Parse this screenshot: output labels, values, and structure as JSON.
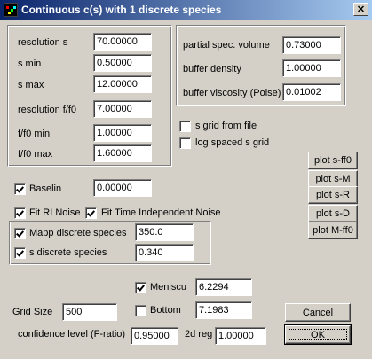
{
  "window": {
    "title": "Continuous c(s) with 1 discrete species",
    "close_glyph": "✕",
    "icon": "sedfit-app-icon"
  },
  "grid_params": {
    "resolution_s": {
      "label": "resolution s",
      "value": "70.00000"
    },
    "s_min": {
      "label": "s min",
      "value": "0.50000"
    },
    "s_max": {
      "label": "s max",
      "value": "12.00000"
    },
    "resolution_ff0": {
      "label": "resolution f/f0",
      "value": "7.00000"
    },
    "ff0_min": {
      "label": "f/f0 min",
      "value": "1.00000"
    },
    "ff0_max": {
      "label": "f/f0 max",
      "value": "1.60000"
    }
  },
  "solution": {
    "partial_spec_volume": {
      "label": "partial spec. volume",
      "value": "0.73000"
    },
    "buffer_density": {
      "label": "buffer density",
      "value": "1.00000"
    },
    "buffer_viscosity": {
      "label": "buffer viscosity (Poise)",
      "value": "0.01002"
    }
  },
  "options": {
    "s_grid_from_file": {
      "label": "s grid from file",
      "checked": false
    },
    "log_spaced_s_grid": {
      "label": "log spaced s grid",
      "checked": false
    }
  },
  "plots": [
    "plot s-ff0",
    "plot s-M",
    "plot s-R",
    "plot s-D",
    "plot M-ff0"
  ],
  "baseline": {
    "label": "Baselin",
    "checked": true,
    "value": "0.00000"
  },
  "noise": {
    "fit_ri": {
      "label": "Fit RI Noise",
      "checked": true
    },
    "fit_ti": {
      "label": "Fit Time Independent Noise",
      "checked": true
    }
  },
  "discrete": {
    "mapp": {
      "label": "Mapp discrete species",
      "checked": true,
      "value": "350.0"
    },
    "s": {
      "label": "s discrete species",
      "checked": true,
      "value": "0.340"
    }
  },
  "meniscus": {
    "label": "Meniscu",
    "checked": true,
    "value": "6.2294"
  },
  "bottom": {
    "label": "Bottom",
    "checked": false,
    "value": "7.1983"
  },
  "grid_size": {
    "label": "Grid Size",
    "value": "500"
  },
  "confidence": {
    "label": "confidence level (F-ratio)",
    "value": "0.95000"
  },
  "reg2d": {
    "label": "2d reg",
    "value": "1.00000"
  },
  "buttons": {
    "cancel": "Cancel",
    "ok": "OK"
  },
  "colors": {
    "titlebar_start": "#0a246a",
    "titlebar_end": "#a6caf0",
    "face": "#d4d0c8"
  }
}
